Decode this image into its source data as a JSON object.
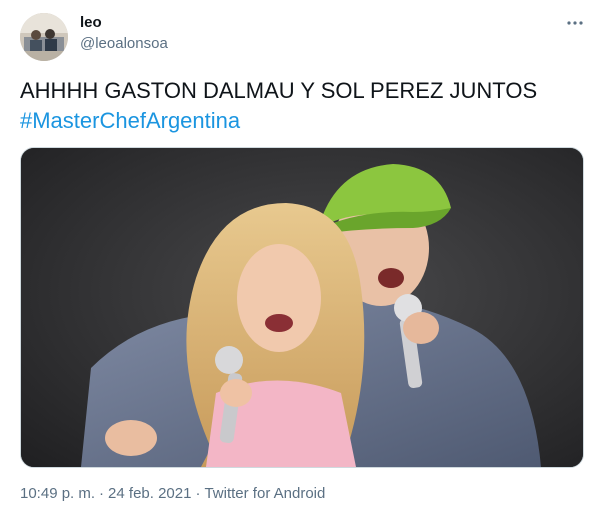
{
  "author": {
    "name": "leo",
    "handle": "@leoalonsoa"
  },
  "tweet": {
    "text": "AHHHH GASTON DALMAU Y SOL PEREZ JUNTOS",
    "hashtag": "#MasterChefArgentina"
  },
  "meta": {
    "time": "10:49 p. m.",
    "separator": "·",
    "date": "24 feb. 2021",
    "source": "Twitter for Android"
  },
  "colors": {
    "text": "#0f1419",
    "secondary": "#5b7083",
    "link": "#1b95e0",
    "media_background": "#2a2a2c"
  },
  "icons": {
    "more": "more-dots-icon"
  }
}
